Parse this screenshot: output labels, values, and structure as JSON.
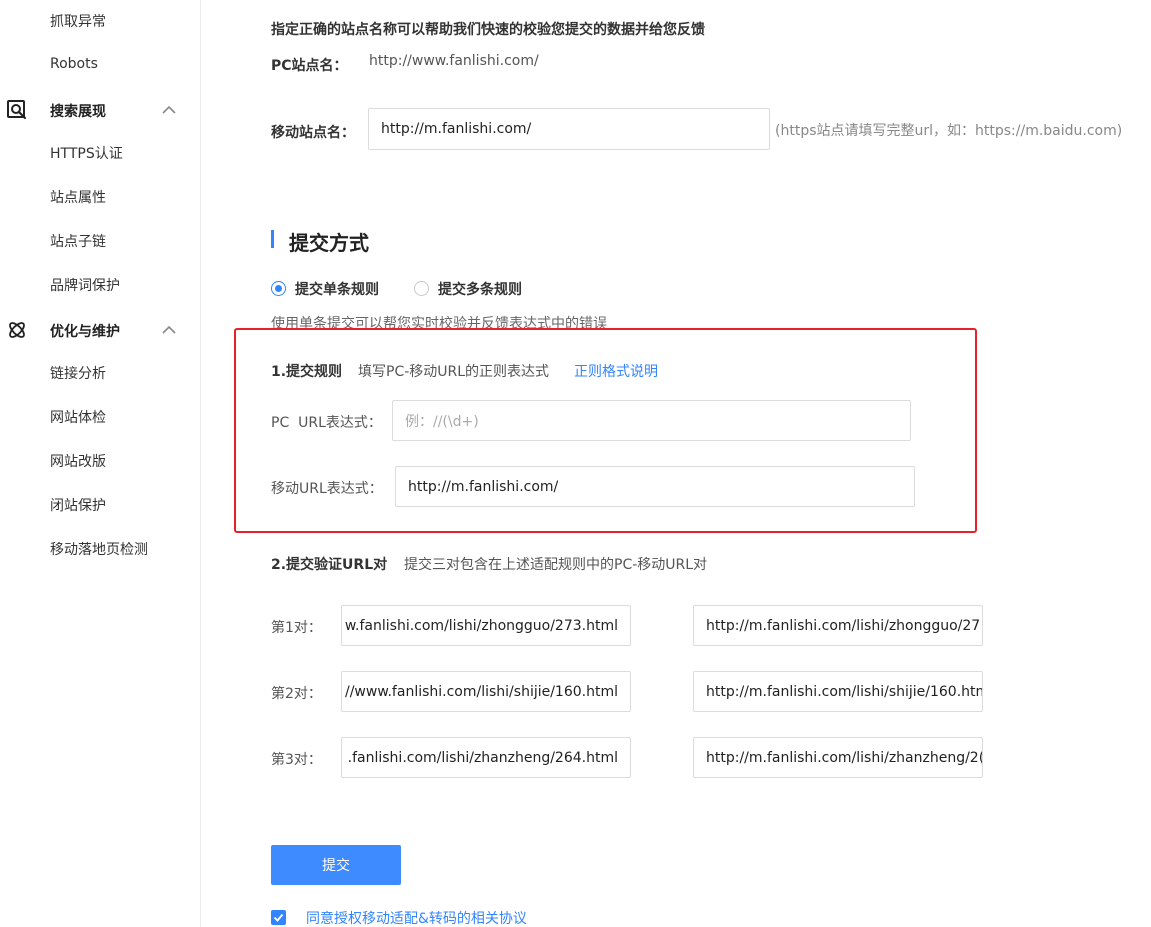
{
  "sidebar": {
    "top_items": [
      "抓取异常",
      "Robots"
    ],
    "groups": [
      {
        "label": "搜索展现",
        "icon": "search-display-icon",
        "items": [
          "HTTPS认证",
          "站点属性",
          "站点子链",
          "品牌词保护"
        ]
      },
      {
        "label": "优化与维护",
        "icon": "atom-icon",
        "items": [
          "链接分析",
          "网站体检",
          "网站改版",
          "闭站保护",
          "移动落地页检测"
        ]
      }
    ]
  },
  "site": {
    "hint": "指定正确的站点名称可以帮助我们快速的校验您提交的数据并给您反馈",
    "pc_label": "PC站点名：",
    "pc_value": "http://www.fanlishi.com/",
    "mobile_label": "移动站点名：",
    "mobile_value": "http://m.fanlishi.com/",
    "mobile_note": "(https站点请填写完整url，如：https://m.baidu.com)"
  },
  "submit_method": {
    "title": "提交方式",
    "options": [
      {
        "label": "提交单条规则",
        "selected": true
      },
      {
        "label": "提交多条规则",
        "selected": false
      }
    ],
    "description": "使用单条提交可以帮您实时校验并反馈表达式中的错误"
  },
  "rule": {
    "step_label": "1.提交规则",
    "step_desc": "填写PC-移动URL的正则表达式",
    "link_label": "正则格式说明",
    "pc_label": "PC  URL表达式：",
    "pc_placeholder": "例：//(\\d+)",
    "mobile_label": "移动URL表达式：",
    "mobile_value": "http://m.fanlishi.com/"
  },
  "pairs": {
    "step_label": "2.提交验证URL对",
    "step_desc": "提交三对包含在上述适配规则中的PC-移动URL对",
    "rows": [
      {
        "label": "第1对：",
        "pc": "w.fanlishi.com/lishi/zhongguo/273.html",
        "mobile": "http://m.fanlishi.com/lishi/zhongguo/27"
      },
      {
        "label": "第2对：",
        "pc": "//www.fanlishi.com/lishi/shijie/160.html",
        "mobile": "http://m.fanlishi.com/lishi/shijie/160.htm"
      },
      {
        "label": "第3对：",
        "pc": ".fanlishi.com/lishi/zhanzheng/264.html",
        "mobile": "http://m.fanlishi.com/lishi/zhanzheng/2("
      }
    ]
  },
  "actions": {
    "submit_label": "提交",
    "agree_checked": true,
    "agree_label": "同意授权移动适配&转码的相关协议"
  },
  "colors": {
    "accent": "#3385ff",
    "highlight_border": "#e8202a",
    "button": "#3d8bff"
  }
}
